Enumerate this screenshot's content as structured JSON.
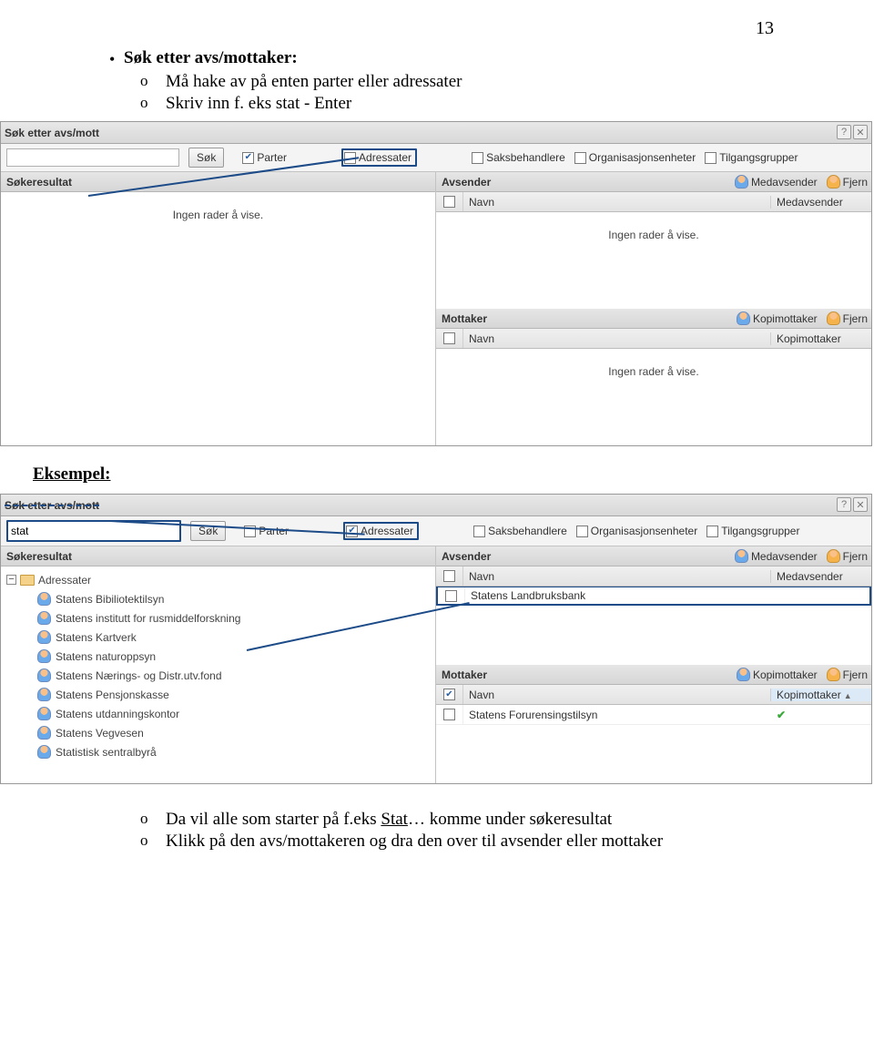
{
  "page_number": "13",
  "intro": {
    "heading": "Søk etter avs/mottaker:",
    "sub1": "Må hake av på enten parter eller adressater",
    "sub2": "Skriv inn f. eks stat - Enter"
  },
  "eksempel_label": "Eksempel:",
  "outro": {
    "line1_pre": "Da vil alle som starter på f.eks ",
    "line1_u": "Stat",
    "line1_post": "… komme under søkeresultat",
    "line2": "Klikk på den avs/mottakeren og dra den over til avsender eller mottaker"
  },
  "ui": {
    "title": "Søk etter avs/mott",
    "search_btn": "Søk",
    "cb_parter": "Parter",
    "cb_adressater": "Adressater",
    "cb_saksbeh": "Saksbehandlere",
    "cb_org": "Organisasjonsenheter",
    "cb_tilgang": "Tilgangsgrupper",
    "sokeresultat": "Søkeresultat",
    "ingen_rader": "Ingen rader å vise.",
    "avsender": "Avsender",
    "medavsender": "Medavsender",
    "fjern": "Fjern",
    "navn": "Navn",
    "mottaker": "Mottaker",
    "kopimottaker": "Kopimottaker",
    "adressater_node": "Adressater"
  },
  "panel2": {
    "search_value": "stat",
    "avsender_row1": "Statens Landbruksbank",
    "mottaker_row1": "Statens Forurensingstilsyn",
    "results": [
      "Statens Bibiliotektilsyn",
      "Statens institutt for rusmiddelforskning",
      "Statens Kartverk",
      "Statens naturoppsyn",
      "Statens Nærings- og Distr.utv.fond",
      "Statens Pensjonskasse",
      "Statens utdanningskontor",
      "Statens Vegvesen",
      "Statistisk sentralbyrå"
    ]
  }
}
